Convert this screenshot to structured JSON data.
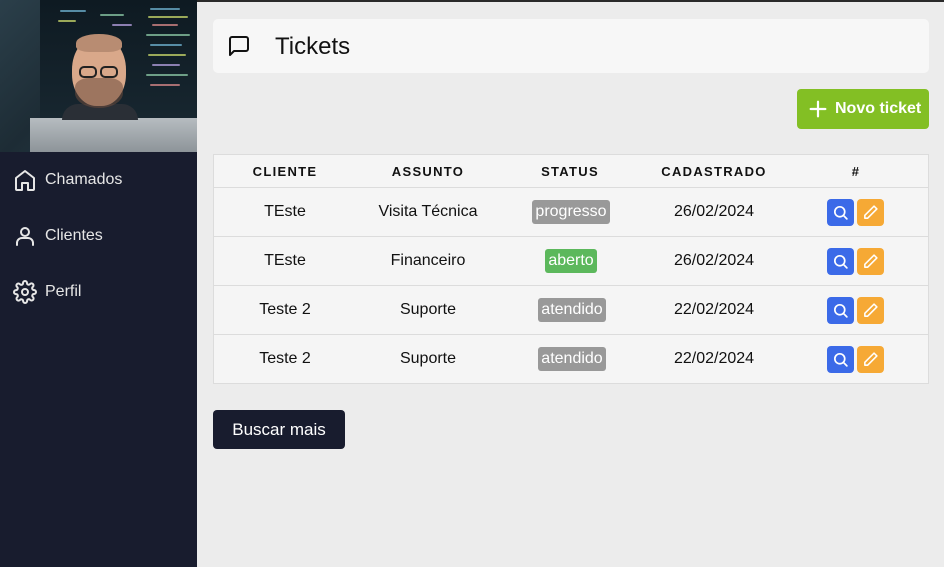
{
  "sidebar": {
    "items": [
      {
        "label": "Chamados",
        "icon": "home-icon"
      },
      {
        "label": "Clientes",
        "icon": "user-icon"
      },
      {
        "label": "Perfil",
        "icon": "gear-icon"
      }
    ]
  },
  "header": {
    "title": "Tickets",
    "icon": "message-icon"
  },
  "actions": {
    "new_ticket": "Novo ticket",
    "load_more": "Buscar mais"
  },
  "table": {
    "headers": [
      "CLIENTE",
      "ASSUNTO",
      "STATUS",
      "CADASTRADO",
      "#"
    ],
    "rows": [
      {
        "cliente": "TEste",
        "assunto": "Visita Técnica",
        "status": "progresso",
        "cadastrado": "26/02/2024"
      },
      {
        "cliente": "TEste",
        "assunto": "Financeiro",
        "status": "aberto",
        "cadastrado": "26/02/2024"
      },
      {
        "cliente": "Teste 2",
        "assunto": "Suporte",
        "status": "atendido",
        "cadastrado": "22/02/2024"
      },
      {
        "cliente": "Teste 2",
        "assunto": "Suporte",
        "status": "atendido",
        "cadastrado": "22/02/2024"
      }
    ]
  },
  "colors": {
    "sidebar": "#181c2e",
    "accent_green": "#83bf24",
    "status_aberto": "#5cb85c",
    "status_neutral": "#999999",
    "search_button": "#3b6ae8",
    "edit_button": "#f6a935"
  }
}
